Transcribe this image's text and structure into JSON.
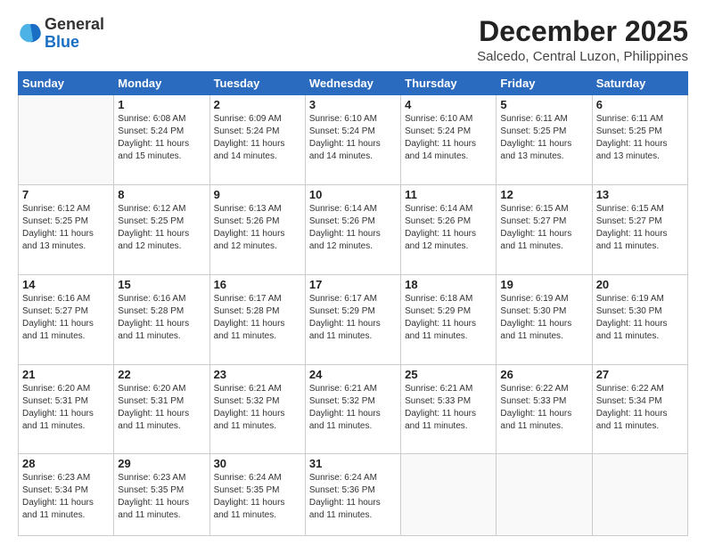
{
  "header": {
    "logo_general": "General",
    "logo_blue": "Blue",
    "month": "December 2025",
    "location": "Salcedo, Central Luzon, Philippines"
  },
  "weekdays": [
    "Sunday",
    "Monday",
    "Tuesday",
    "Wednesday",
    "Thursday",
    "Friday",
    "Saturday"
  ],
  "weeks": [
    [
      {
        "day": "",
        "sunrise": "",
        "sunset": "",
        "daylight": ""
      },
      {
        "day": "1",
        "sunrise": "Sunrise: 6:08 AM",
        "sunset": "Sunset: 5:24 PM",
        "daylight": "Daylight: 11 hours and 15 minutes."
      },
      {
        "day": "2",
        "sunrise": "Sunrise: 6:09 AM",
        "sunset": "Sunset: 5:24 PM",
        "daylight": "Daylight: 11 hours and 14 minutes."
      },
      {
        "day": "3",
        "sunrise": "Sunrise: 6:10 AM",
        "sunset": "Sunset: 5:24 PM",
        "daylight": "Daylight: 11 hours and 14 minutes."
      },
      {
        "day": "4",
        "sunrise": "Sunrise: 6:10 AM",
        "sunset": "Sunset: 5:24 PM",
        "daylight": "Daylight: 11 hours and 14 minutes."
      },
      {
        "day": "5",
        "sunrise": "Sunrise: 6:11 AM",
        "sunset": "Sunset: 5:25 PM",
        "daylight": "Daylight: 11 hours and 13 minutes."
      },
      {
        "day": "6",
        "sunrise": "Sunrise: 6:11 AM",
        "sunset": "Sunset: 5:25 PM",
        "daylight": "Daylight: 11 hours and 13 minutes."
      }
    ],
    [
      {
        "day": "7",
        "sunrise": "Sunrise: 6:12 AM",
        "sunset": "Sunset: 5:25 PM",
        "daylight": "Daylight: 11 hours and 13 minutes."
      },
      {
        "day": "8",
        "sunrise": "Sunrise: 6:12 AM",
        "sunset": "Sunset: 5:25 PM",
        "daylight": "Daylight: 11 hours and 12 minutes."
      },
      {
        "day": "9",
        "sunrise": "Sunrise: 6:13 AM",
        "sunset": "Sunset: 5:26 PM",
        "daylight": "Daylight: 11 hours and 12 minutes."
      },
      {
        "day": "10",
        "sunrise": "Sunrise: 6:14 AM",
        "sunset": "Sunset: 5:26 PM",
        "daylight": "Daylight: 11 hours and 12 minutes."
      },
      {
        "day": "11",
        "sunrise": "Sunrise: 6:14 AM",
        "sunset": "Sunset: 5:26 PM",
        "daylight": "Daylight: 11 hours and 12 minutes."
      },
      {
        "day": "12",
        "sunrise": "Sunrise: 6:15 AM",
        "sunset": "Sunset: 5:27 PM",
        "daylight": "Daylight: 11 hours and 11 minutes."
      },
      {
        "day": "13",
        "sunrise": "Sunrise: 6:15 AM",
        "sunset": "Sunset: 5:27 PM",
        "daylight": "Daylight: 11 hours and 11 minutes."
      }
    ],
    [
      {
        "day": "14",
        "sunrise": "Sunrise: 6:16 AM",
        "sunset": "Sunset: 5:27 PM",
        "daylight": "Daylight: 11 hours and 11 minutes."
      },
      {
        "day": "15",
        "sunrise": "Sunrise: 6:16 AM",
        "sunset": "Sunset: 5:28 PM",
        "daylight": "Daylight: 11 hours and 11 minutes."
      },
      {
        "day": "16",
        "sunrise": "Sunrise: 6:17 AM",
        "sunset": "Sunset: 5:28 PM",
        "daylight": "Daylight: 11 hours and 11 minutes."
      },
      {
        "day": "17",
        "sunrise": "Sunrise: 6:17 AM",
        "sunset": "Sunset: 5:29 PM",
        "daylight": "Daylight: 11 hours and 11 minutes."
      },
      {
        "day": "18",
        "sunrise": "Sunrise: 6:18 AM",
        "sunset": "Sunset: 5:29 PM",
        "daylight": "Daylight: 11 hours and 11 minutes."
      },
      {
        "day": "19",
        "sunrise": "Sunrise: 6:19 AM",
        "sunset": "Sunset: 5:30 PM",
        "daylight": "Daylight: 11 hours and 11 minutes."
      },
      {
        "day": "20",
        "sunrise": "Sunrise: 6:19 AM",
        "sunset": "Sunset: 5:30 PM",
        "daylight": "Daylight: 11 hours and 11 minutes."
      }
    ],
    [
      {
        "day": "21",
        "sunrise": "Sunrise: 6:20 AM",
        "sunset": "Sunset: 5:31 PM",
        "daylight": "Daylight: 11 hours and 11 minutes."
      },
      {
        "day": "22",
        "sunrise": "Sunrise: 6:20 AM",
        "sunset": "Sunset: 5:31 PM",
        "daylight": "Daylight: 11 hours and 11 minutes."
      },
      {
        "day": "23",
        "sunrise": "Sunrise: 6:21 AM",
        "sunset": "Sunset: 5:32 PM",
        "daylight": "Daylight: 11 hours and 11 minutes."
      },
      {
        "day": "24",
        "sunrise": "Sunrise: 6:21 AM",
        "sunset": "Sunset: 5:32 PM",
        "daylight": "Daylight: 11 hours and 11 minutes."
      },
      {
        "day": "25",
        "sunrise": "Sunrise: 6:21 AM",
        "sunset": "Sunset: 5:33 PM",
        "daylight": "Daylight: 11 hours and 11 minutes."
      },
      {
        "day": "26",
        "sunrise": "Sunrise: 6:22 AM",
        "sunset": "Sunset: 5:33 PM",
        "daylight": "Daylight: 11 hours and 11 minutes."
      },
      {
        "day": "27",
        "sunrise": "Sunrise: 6:22 AM",
        "sunset": "Sunset: 5:34 PM",
        "daylight": "Daylight: 11 hours and 11 minutes."
      }
    ],
    [
      {
        "day": "28",
        "sunrise": "Sunrise: 6:23 AM",
        "sunset": "Sunset: 5:34 PM",
        "daylight": "Daylight: 11 hours and 11 minutes."
      },
      {
        "day": "29",
        "sunrise": "Sunrise: 6:23 AM",
        "sunset": "Sunset: 5:35 PM",
        "daylight": "Daylight: 11 hours and 11 minutes."
      },
      {
        "day": "30",
        "sunrise": "Sunrise: 6:24 AM",
        "sunset": "Sunset: 5:35 PM",
        "daylight": "Daylight: 11 hours and 11 minutes."
      },
      {
        "day": "31",
        "sunrise": "Sunrise: 6:24 AM",
        "sunset": "Sunset: 5:36 PM",
        "daylight": "Daylight: 11 hours and 11 minutes."
      },
      {
        "day": "",
        "sunrise": "",
        "sunset": "",
        "daylight": ""
      },
      {
        "day": "",
        "sunrise": "",
        "sunset": "",
        "daylight": ""
      },
      {
        "day": "",
        "sunrise": "",
        "sunset": "",
        "daylight": ""
      }
    ]
  ]
}
